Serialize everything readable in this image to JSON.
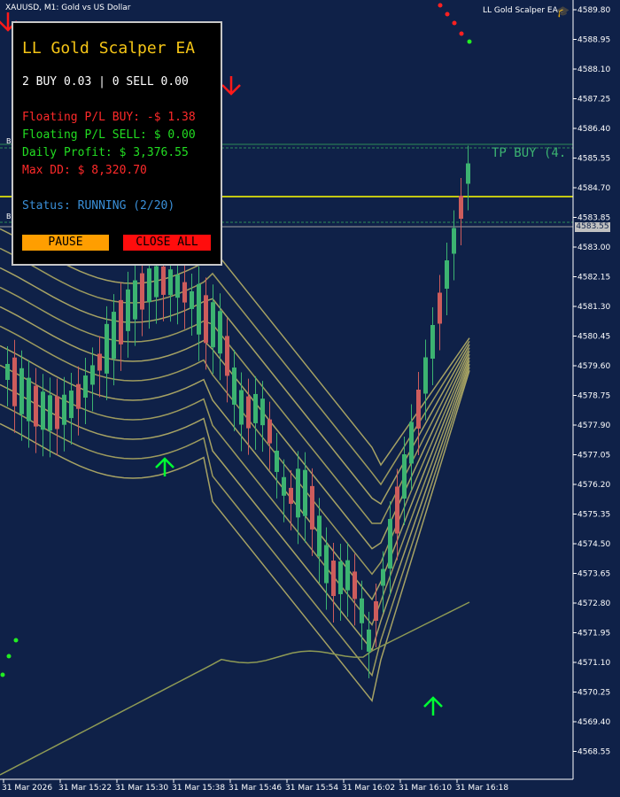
{
  "header": {
    "symbol_info": "XAUUSD, M1:  Gold vs US Dollar",
    "ea_name": "LL Gold Scalper EA"
  },
  "panel": {
    "title": "LL Gold Scalper EA",
    "positions": "2 BUY 0.03 | 0 SELL 0.00",
    "floating_buy": "Floating P/L BUY: -$ 1.38",
    "floating_sell": "Floating P/L SELL: $ 0.00",
    "daily_profit": "Daily Profit: $ 3,376.55",
    "max_dd": "Max DD: $ 8,320.70",
    "status": "Status: RUNNING (2/20)",
    "pause_label": "PAUSE",
    "close_all_label": "CLOSE ALL"
  },
  "chart_labels": {
    "tp_buy": "TP BUY (4.",
    "current_price": "4583.55",
    "b_marker": "B"
  },
  "colors": {
    "background": "#0f2148",
    "bull_candle": "#3cb371",
    "bear_candle": "#cd5c5c",
    "tp_line": "#2e8b57",
    "price_line": "#ffff00",
    "title": "#f5c516",
    "buy_loss": "#ff2a2a",
    "sell_green": "#22dd22",
    "status_blue": "#3a8fd8"
  },
  "chart_data": {
    "type": "candlestick",
    "symbol": "XAUUSD",
    "timeframe": "M1",
    "y_ticks": [
      "4589.80",
      "4588.95",
      "4588.10",
      "4587.25",
      "4586.40",
      "4585.55",
      "4584.70",
      "4583.85",
      "4583.00",
      "4582.15",
      "4581.30",
      "4580.45",
      "4579.60",
      "4578.75",
      "4577.90",
      "4577.05",
      "4576.20",
      "4575.35",
      "4574.50",
      "4573.65",
      "4572.80",
      "4571.95",
      "4571.10",
      "4570.25",
      "4569.40",
      "4568.55"
    ],
    "x_ticks": [
      "31 Mar 2026",
      "31 Mar 15:22",
      "31 Mar 15:30",
      "31 Mar 15:38",
      "31 Mar 15:46",
      "31 Mar 15:54",
      "31 Mar 16:02",
      "31 Mar 16:10",
      "31 Mar 16:18"
    ],
    "current_price": 4583.55
  }
}
